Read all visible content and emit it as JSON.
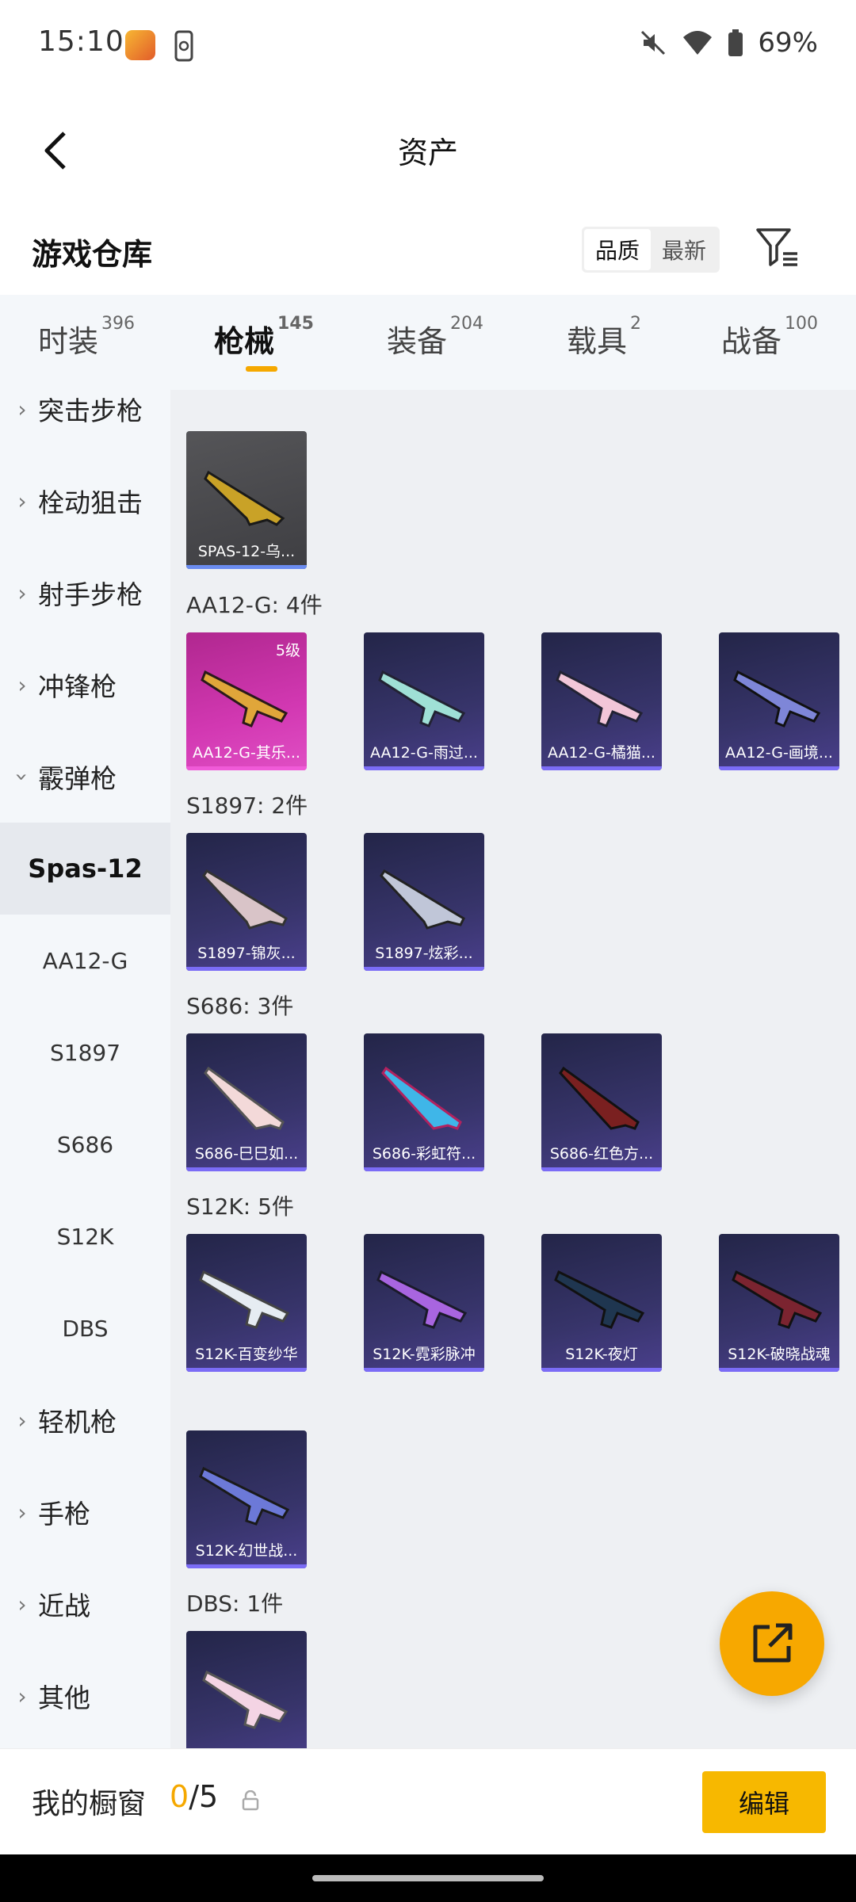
{
  "status_bar": {
    "time": "15:10",
    "battery": "69%"
  },
  "header": {
    "title": "资产"
  },
  "warehouse": {
    "title": "游戏仓库",
    "sort": [
      "品质",
      "最新"
    ]
  },
  "tabs": [
    {
      "label": "时装",
      "count": "396"
    },
    {
      "label": "枪械",
      "count": "145"
    },
    {
      "label": "装备",
      "count": "204"
    },
    {
      "label": "载具",
      "count": "2"
    },
    {
      "label": "战备",
      "count": "100"
    }
  ],
  "sidebar": {
    "categories": [
      "突击步枪",
      "栓动狙击",
      "射手步枪",
      "冲锋枪",
      "霰弹枪",
      "轻机枪",
      "手枪",
      "近战",
      "其他"
    ],
    "subcategories": [
      "Spas-12",
      "AA12-G",
      "S1897",
      "S686",
      "S12K",
      "DBS"
    ]
  },
  "groups": {
    "g0": {
      "items": [
        "SPAS-12-乌..."
      ]
    },
    "g1": {
      "label": "AA12-G: 4件",
      "level": "5级",
      "items": [
        "AA12-G-其乐...",
        "AA12-G-雨过...",
        "AA12-G-橘猫...",
        "AA12-G-画境..."
      ]
    },
    "g2": {
      "label": "S1897: 2件",
      "items": [
        "S1897-锦灰...",
        "S1897-炫彩..."
      ]
    },
    "g3": {
      "label": "S686: 3件",
      "items": [
        "S686-巳巳如...",
        "S686-彩虹符...",
        "S686-红色方..."
      ]
    },
    "g4": {
      "label": "S12K: 5件",
      "items": [
        "S12K-百变纱华",
        "S12K-霓彩脉冲",
        "S12K-夜灯",
        "S12K-破晓战魂",
        "S12K-幻世战..."
      ]
    },
    "g5": {
      "label": "DBS: 1件"
    }
  },
  "bottom": {
    "showcase_label": "我的橱窗",
    "current": "0",
    "total": "/5",
    "edit_label": "编辑"
  },
  "colors": {
    "accent": "#f7b800",
    "rare_card": "#3a3570",
    "legendary_card": "#d238b2"
  }
}
